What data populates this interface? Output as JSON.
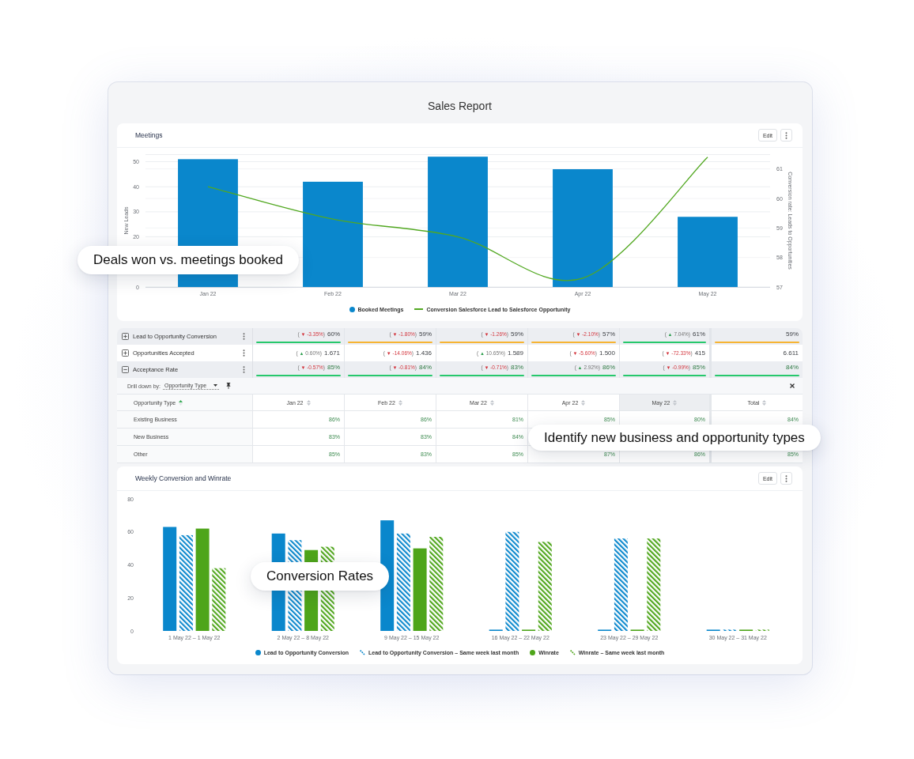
{
  "report": {
    "title": "Sales Report"
  },
  "meetings": {
    "title": "Meetings",
    "actions": [
      {
        "kind": "text",
        "label": "Edit"
      },
      {
        "kind": "menu"
      }
    ],
    "callout": "Deals won vs. meetings booked",
    "chart_data": {
      "type": "bar",
      "legend": "bottom",
      "grid": true,
      "categories": [
        "Jan 22",
        "Feb 22",
        "Mar 22",
        "Apr 22",
        "May 22"
      ],
      "ylabel": "New Leads",
      "ylim": [
        0,
        53
      ],
      "yticks": [
        0,
        20,
        30,
        40,
        50
      ],
      "y2label": "Conversion rate: Leads to Opportunities",
      "y2lim": [
        57,
        61.5
      ],
      "y2ticks": [
        57,
        58,
        59,
        60,
        61
      ],
      "series": [
        {
          "name": "Booked Meetings",
          "type": "bar",
          "color": "#0a87cc",
          "values": [
            51,
            42,
            52,
            47,
            28
          ]
        },
        {
          "name": "Conversion Salesforce Lead to Salesforce Opportunity",
          "type": "line",
          "axis": "y2",
          "color": "#52a821",
          "values": [
            60.4,
            59.3,
            58.7,
            57.3,
            61.4
          ]
        }
      ]
    }
  },
  "metrics": {
    "rows": [
      {
        "label": "Lead to Opportunity Conversion",
        "expanded": false,
        "positive": false,
        "cells": [
          {
            "delta": {
              "open": "(",
              "arrow": "▼",
              "change": "-3.35%",
              "close": ")",
              "increase": false
            },
            "value": "60%",
            "color": "#27c86c"
          },
          {
            "delta": {
              "open": "(",
              "arrow": "▼",
              "change": "-1.80%",
              "close": ")",
              "increase": false
            },
            "value": "59%",
            "color": "#f6b433"
          },
          {
            "delta": {
              "open": "(",
              "arrow": "▼",
              "change": "-1.26%",
              "close": ")",
              "increase": false
            },
            "value": "59%",
            "color": "#f6b433"
          },
          {
            "delta": {
              "open": "(",
              "arrow": "▼",
              "change": "-2.10%",
              "close": ")",
              "increase": false
            },
            "value": "57%",
            "color": "#f6b433"
          },
          {
            "delta": {
              "open": "(",
              "arrow": "▲",
              "change": "7.04%",
              "close": ")",
              "increase": true
            },
            "value": "61%",
            "color": "#27c86c"
          },
          {
            "value": "59%",
            "color": "#f6b433"
          }
        ]
      },
      {
        "label": "Opportunities Accepted",
        "expanded": false,
        "positive": false,
        "cells": [
          {
            "delta": {
              "open": "(",
              "arrow": "▲",
              "change": "0.60%",
              "close": ")",
              "increase": true
            },
            "value": "1.671"
          },
          {
            "delta": {
              "open": "(",
              "arrow": "▼",
              "change": "-14.06%",
              "close": ")",
              "increase": false
            },
            "value": "1.436"
          },
          {
            "delta": {
              "open": "(",
              "arrow": "▲",
              "change": "10.65%",
              "close": ")",
              "increase": true
            },
            "value": "1.589"
          },
          {
            "delta": {
              "open": "(",
              "arrow": "▼",
              "change": "-5.60%",
              "close": ")",
              "increase": false
            },
            "value": "1.500"
          },
          {
            "delta": {
              "open": "(",
              "arrow": "▼",
              "change": "-72.33%",
              "close": ")",
              "increase": false
            },
            "value": "415"
          },
          {
            "value": "6.611"
          }
        ]
      },
      {
        "label": "Acceptance Rate",
        "expanded": true,
        "positive": true,
        "cells": [
          {
            "delta": {
              "open": "(",
              "arrow": "▼",
              "change": "-0.57%",
              "close": ")",
              "increase": false
            },
            "value": "85%",
            "color": "#27c86c"
          },
          {
            "delta": {
              "open": "(",
              "arrow": "▼",
              "change": "-0.81%",
              "close": ")",
              "increase": false
            },
            "value": "84%",
            "color": "#27c86c"
          },
          {
            "delta": {
              "open": "(",
              "arrow": "▼",
              "change": "-0.71%",
              "close": ")",
              "increase": false
            },
            "value": "83%",
            "color": "#27c86c"
          },
          {
            "delta": {
              "open": "(",
              "arrow": "▲",
              "change": "2.92%",
              "close": ")",
              "increase": true
            },
            "value": "86%",
            "color": "#27c86c"
          },
          {
            "delta": {
              "open": "(",
              "arrow": "▼",
              "change": "-0.99%",
              "close": ")",
              "increase": false
            },
            "value": "85%",
            "color": "#27c86c"
          },
          {
            "value": "84%",
            "color": "#27c86c"
          }
        ]
      }
    ]
  },
  "drilldown": {
    "label": "Drill down by:",
    "value": "Opportunity Type",
    "columns": [
      {
        "label": "Opportunity Type",
        "sorted": true,
        "highlighted": false
      },
      {
        "label": "Jan 22",
        "sorted": false,
        "highlighted": false
      },
      {
        "label": "Feb 22",
        "sorted": false,
        "highlighted": false
      },
      {
        "label": "Mar 22",
        "sorted": false,
        "highlighted": false
      },
      {
        "label": "Apr 22",
        "sorted": false,
        "highlighted": false
      },
      {
        "label": "May 22",
        "sorted": false,
        "highlighted": true
      },
      {
        "label": "Total",
        "sorted": false,
        "highlighted": false
      }
    ],
    "rows": [
      {
        "label": "Existing Business",
        "cells": [
          "86%",
          "86%",
          "81%",
          "85%",
          "80%",
          "84%"
        ]
      },
      {
        "label": "New Business",
        "cells": [
          "83%",
          "83%",
          "84%"
        ]
      },
      {
        "label": "Other",
        "cells": [
          "85%",
          "83%",
          "85%",
          "87%",
          "86%",
          "85%"
        ]
      }
    ],
    "callout": "Identify new business and opportunity types"
  },
  "weekly": {
    "title": "Weekly Conversion and Winrate",
    "actions": [
      {
        "kind": "text",
        "label": "Edit"
      },
      {
        "kind": "menu"
      }
    ],
    "callout": "Conversion Rates",
    "series_fills": [
      {
        "kind": "solid"
      },
      {
        "kind": "hatched"
      },
      {
        "kind": "solid"
      },
      {
        "kind": "hatched"
      }
    ],
    "chart_data": {
      "type": "bar",
      "legend": "bottom",
      "categories": [
        "1 May 22 – 1 May 22",
        "2 May 22 – 8 May 22",
        "9 May 22 – 15 May 22",
        "16 May 22 – 22 May 22",
        "23 May 22 – 29 May 22",
        "30 May 22 – 31 May 22"
      ],
      "ylim": [
        0,
        80
      ],
      "yticks": [
        0,
        20,
        40,
        60,
        80
      ],
      "series": [
        {
          "name": "Lead to Opportunity Conversion",
          "color": "#0a87cc",
          "values": [
            63,
            59,
            67,
            0,
            0,
            0
          ]
        },
        {
          "name": "Lead to Opportunity Conversion – Same week last month",
          "color": "#0a87cc",
          "values": [
            58,
            55,
            59,
            60,
            56,
            0
          ]
        },
        {
          "name": "Winrate",
          "color": "#4ea51a",
          "values": [
            62,
            49,
            50,
            0,
            0,
            0
          ]
        },
        {
          "name": "Winrate – Same week last month",
          "color": "#4ea51a",
          "values": [
            38,
            51,
            57,
            54,
            56,
            0
          ]
        }
      ]
    }
  }
}
